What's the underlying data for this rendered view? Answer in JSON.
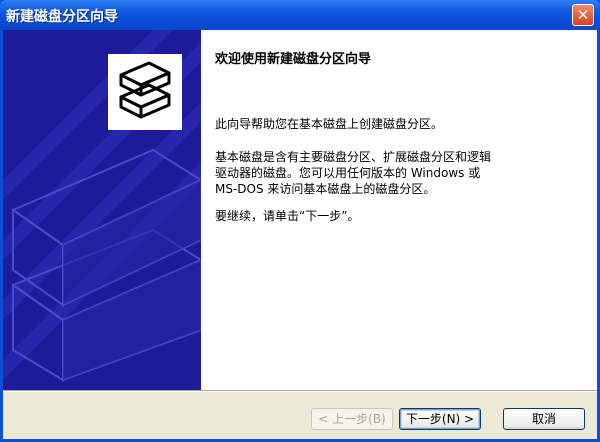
{
  "window": {
    "title": "新建磁盘分区向导",
    "close_icon": "close-icon"
  },
  "main": {
    "heading": "欢迎使用新建磁盘分区向导",
    "para1": "此向导帮助您在基本磁盘上创建磁盘分区。",
    "para2_line1": "基本磁盘是含有主要磁盘分区、扩展磁盘分区和逻辑",
    "para2_line2": "驱动器的磁盘。您可以用任何版本的 Windows 或",
    "para2_line3": "MS-DOS 来访问基本磁盘上的磁盘分区。",
    "para3": "要继续，请单击“下一步”。"
  },
  "buttons": {
    "back": "< 上一步(B)",
    "next": "下一步(N) >",
    "cancel": "取消"
  },
  "colors": {
    "title_bar": "#0a4cd5",
    "sidebar": "#1e1b9a"
  }
}
